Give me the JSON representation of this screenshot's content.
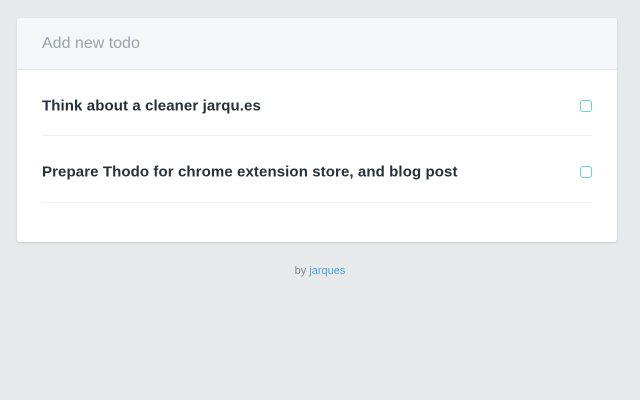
{
  "new_todo": {
    "placeholder": "Add new todo",
    "value": ""
  },
  "todos": [
    {
      "text": "Think about a cleaner jarqu.es",
      "done": false
    },
    {
      "text": "Prepare Thodo for chrome extension store, and blog post",
      "done": false
    }
  ],
  "footer": {
    "prefix": "by ",
    "link_text": "jarques"
  },
  "colors": {
    "background": "#e7eaeb",
    "checkbox_border": "#6fcfd9",
    "link": "#4a9fd8",
    "todo_text": "#26313b"
  }
}
